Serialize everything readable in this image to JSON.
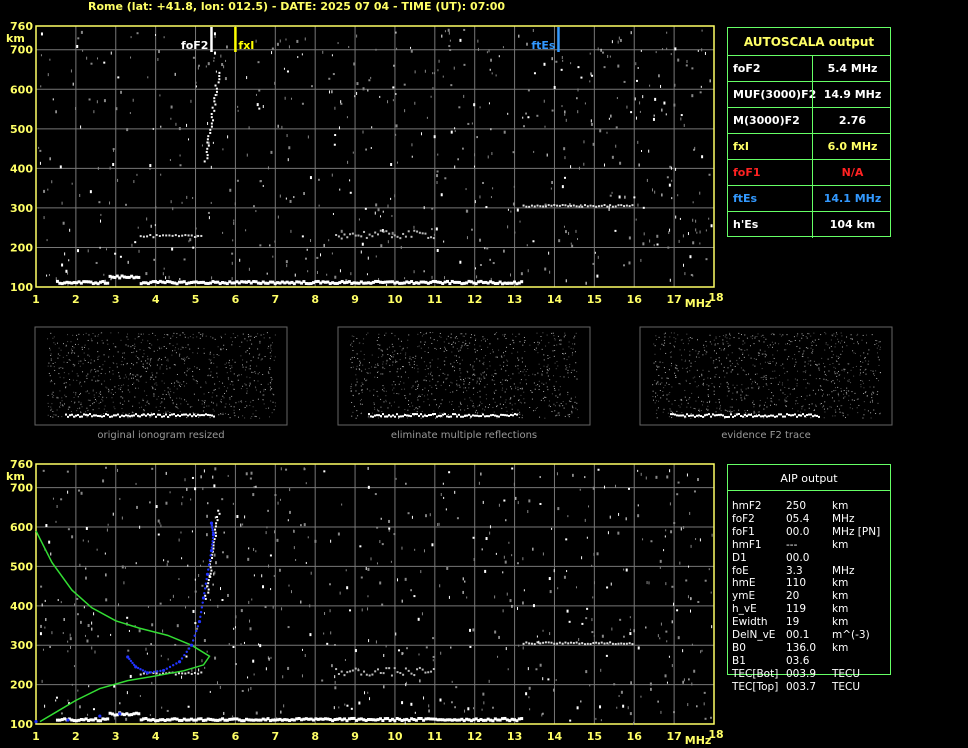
{
  "header": "Rome (lat: +41.8, lon: 012.5) - DATE: 2025 07 04 - TIME (UT): 07:00",
  "colors": {
    "frame": "#ffff66",
    "grid": "#777777",
    "green_box": "#66ff66",
    "foF2": "#ffffff",
    "fxI": "#ffff00",
    "ftEs": "#3399ff",
    "foF1": "#ff2222",
    "profile": "#33dd33",
    "trace": "#2233ff"
  },
  "chart_data": [
    {
      "type": "scatter",
      "title": "",
      "xlabel": "MHz",
      "ylabel": "km",
      "xlim": [
        1,
        18
      ],
      "ylim": [
        100,
        760
      ],
      "x_ticks": [
        "1",
        "2",
        "3",
        "4",
        "5",
        "6",
        "7",
        "8",
        "9",
        "10",
        "11",
        "12",
        "13",
        "14",
        "15",
        "16",
        "17",
        "18"
      ],
      "y_ticks": [
        "100",
        "200",
        "300",
        "400",
        "500",
        "600",
        "700",
        "760"
      ],
      "markers": [
        {
          "name": "foF2",
          "x": 5.4
        },
        {
          "name": "fxI",
          "x": 6.0
        },
        {
          "name": "ftEs",
          "x": 14.1
        }
      ]
    },
    {
      "type": "line",
      "title": "",
      "xlabel": "MHz",
      "ylabel": "km",
      "xlim": [
        1,
        18
      ],
      "ylim": [
        100,
        760
      ],
      "x_ticks": [
        "1",
        "2",
        "3",
        "4",
        "5",
        "6",
        "7",
        "8",
        "9",
        "10",
        "11",
        "12",
        "13",
        "14",
        "15",
        "16",
        "17",
        "18"
      ],
      "y_ticks": [
        "100",
        "200",
        "300",
        "400",
        "500",
        "600",
        "700",
        "760"
      ],
      "series": [
        {
          "values_fh": [
            [
              1.0,
              590
            ],
            [
              1.4,
              510
            ],
            [
              1.9,
              440
            ],
            [
              2.4,
              395
            ],
            [
              3.0,
              362
            ],
            [
              3.6,
              343
            ],
            [
              4.3,
              325
            ],
            [
              4.9,
              300
            ],
            [
              5.35,
              272
            ],
            [
              5.2,
              250
            ],
            [
              4.7,
              235
            ],
            [
              4.0,
              222
            ],
            [
              3.3,
              210
            ],
            [
              2.6,
              190
            ],
            [
              2.0,
              160
            ],
            [
              1.5,
              130
            ],
            [
              1.1,
              106
            ]
          ]
        },
        {
          "values_fh": [
            [
              3.3,
              270
            ],
            [
              3.5,
              245
            ],
            [
              3.8,
              230
            ],
            [
              4.2,
              236
            ],
            [
              4.6,
              258
            ],
            [
              4.9,
              300
            ],
            [
              5.1,
              360
            ],
            [
              5.2,
              420
            ],
            [
              5.3,
              480
            ],
            [
              5.4,
              540
            ],
            [
              5.45,
              580
            ],
            [
              5.4,
              610
            ],
            [
              1.0,
              106
            ],
            [
              1.8,
              110
            ],
            [
              2.6,
              120
            ],
            [
              3.1,
              126
            ]
          ]
        }
      ]
    }
  ],
  "autoscala": {
    "title": "AUTOSCALA output",
    "rows": [
      {
        "key": "foF2",
        "value": "5.4 MHz",
        "color": "#ffffff"
      },
      {
        "key": "MUF(3000)F2",
        "value": "14.9 MHz",
        "color": "#ffffff"
      },
      {
        "key": "M(3000)F2",
        "value": "2.76",
        "color": "#ffffff"
      },
      {
        "key": "fxI",
        "value": "6.0 MHz",
        "color": "#ffff66"
      },
      {
        "key": "foF1",
        "value": "N/A",
        "color": "#ff2222"
      },
      {
        "key": "ftEs",
        "value": "14.1 MHz",
        "color": "#3399ff"
      },
      {
        "key": "h'Es",
        "value": "104    km",
        "color": "#ffffff"
      }
    ]
  },
  "aip": {
    "title": "AIP output",
    "rows": [
      {
        "key": "hmF2",
        "val": "250",
        "unit": "km"
      },
      {
        "key": "foF2",
        "val": "05.4",
        "unit": "MHz"
      },
      {
        "key": "foF1",
        "val": "00.0",
        "unit": "MHz   [PN]"
      },
      {
        "key": "hmF1",
        "val": "---",
        "unit": "km"
      },
      {
        "key": "D1",
        "val": "00.0",
        "unit": ""
      },
      {
        "key": "foE",
        "val": "3.3",
        "unit": "MHz"
      },
      {
        "key": "hmE",
        "val": "110",
        "unit": "km"
      },
      {
        "key": "ymE",
        "val": "20",
        "unit": "km"
      },
      {
        "key": "h_vE",
        "val": "119",
        "unit": "km"
      },
      {
        "key": "Ewidth",
        "val": "19",
        "unit": "km"
      },
      {
        "key": "DelN_vE",
        "val": "00.1",
        "unit": "m^(-3)"
      },
      {
        "key": "B0",
        "val": "136.0",
        "unit": "km"
      },
      {
        "key": "B1",
        "val": "03.6",
        "unit": ""
      },
      {
        "key": "TEC[Bot]",
        "val": "003.9",
        "unit": "TECU"
      },
      {
        "key": "TEC[Top]",
        "val": "003.7",
        "unit": "TECU"
      }
    ]
  },
  "thumbnails": [
    {
      "caption": "original ionogram resized"
    },
    {
      "caption": "eliminate multiple reflections"
    },
    {
      "caption": "evidence F2 trace"
    }
  ]
}
